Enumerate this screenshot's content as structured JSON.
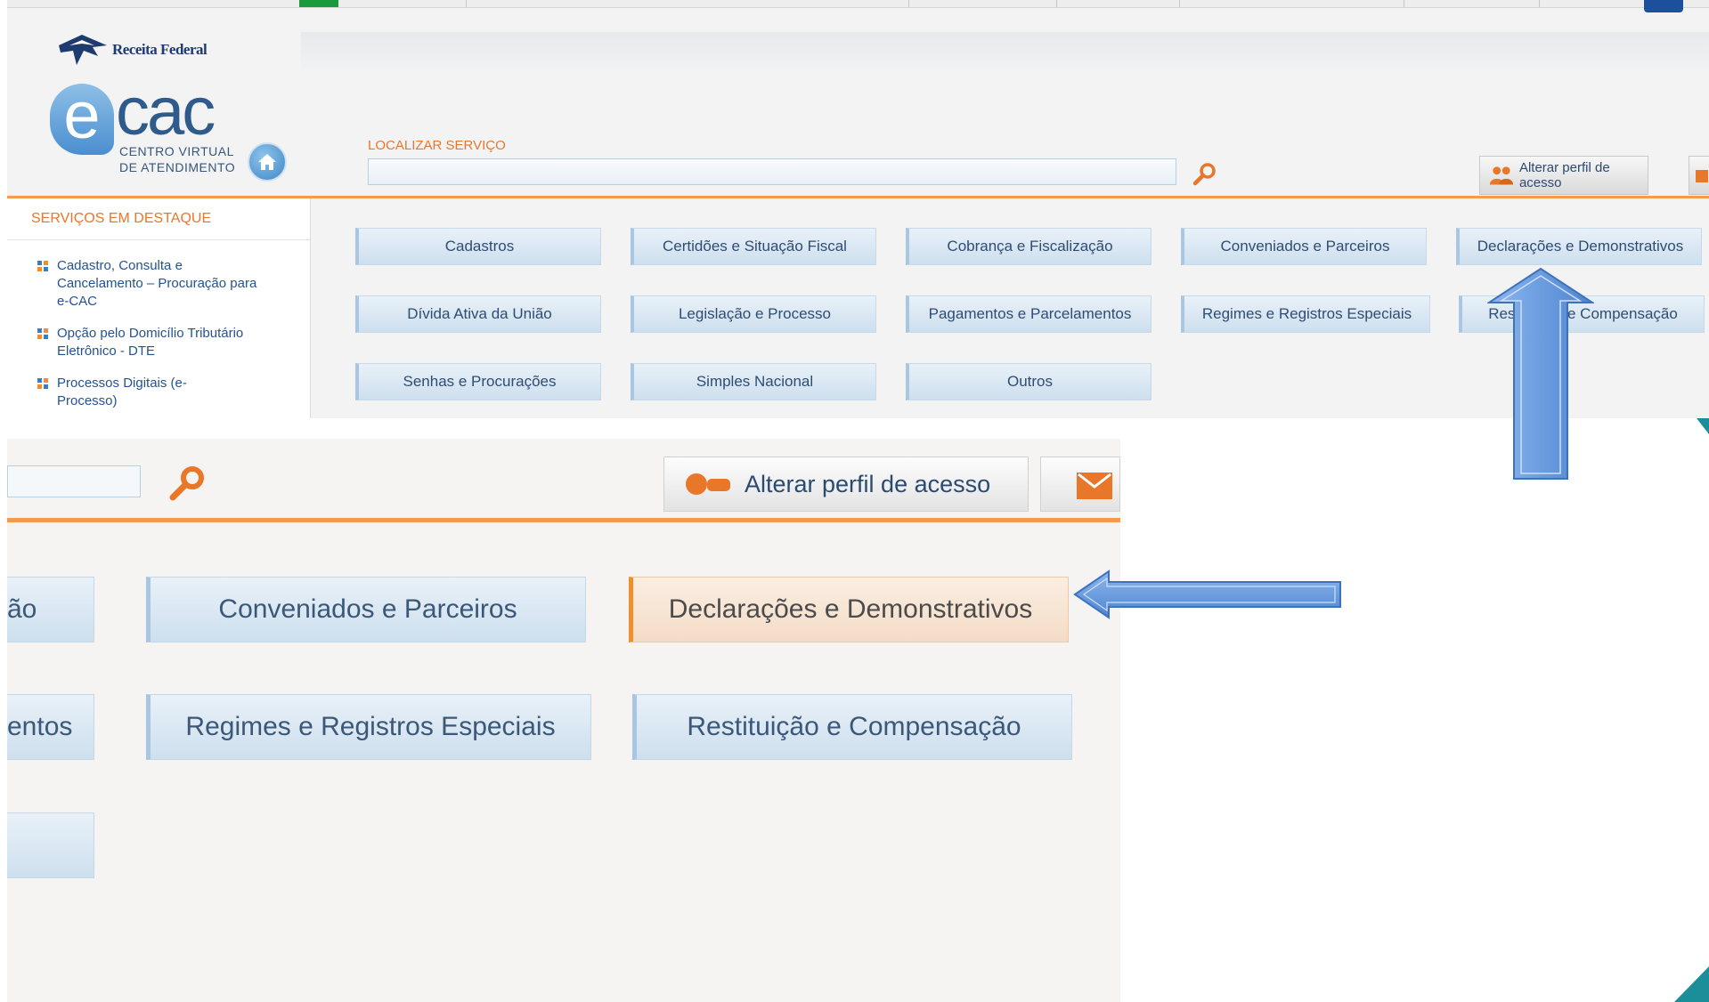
{
  "header": {
    "org_name": "Receita Federal",
    "logo_main": "cac",
    "logo_e": "e",
    "logo_sub_1": "CENTRO VIRTUAL",
    "logo_sub_2": "DE ATENDIMENTO",
    "home_icon": "home-icon"
  },
  "search": {
    "label": "LOCALIZAR SERVIÇO",
    "value": "",
    "placeholder": "",
    "icon": "magnifier-icon"
  },
  "toolbar": {
    "profile_label": "Alterar perfil de acesso",
    "profile_icon": "users-icon"
  },
  "featured": {
    "title": "SERVIÇOS EM DESTAQUE",
    "items": [
      {
        "label": "Cadastro, Consulta e Cancelamento – Procuração para e-CAC"
      },
      {
        "label": "Opção pelo Domicílio Tributário Eletrônico - DTE"
      },
      {
        "label": "Processos Digitais (e-Processo)"
      }
    ]
  },
  "menu": {
    "row1": [
      "Cadastros",
      "Certidões e Situação Fiscal",
      "Cobrança e Fiscalização",
      "Conveniados e Parceiros",
      "Declarações e Demonstrativos"
    ],
    "row2": [
      "Dívida Ativa da União",
      "Legislação e Processo",
      "Pagamentos e Parcelamentos",
      "Regimes e Registros Especiais",
      "Restituição e Compensação"
    ],
    "row3": [
      "Senhas e Procurações",
      "Simples Nacional",
      "Outros"
    ]
  },
  "zoom": {
    "partial_1": "ão",
    "partial_2": "entos",
    "conveniados": "Conveniados e Parceiros",
    "declaracoes": "Declarações e Demonstrativos",
    "regimes": "Regimes e Registros Especiais",
    "restituicao": "Restituição e Compensação",
    "profile_label": "Alterar perfil de acesso"
  },
  "colors": {
    "accent_orange": "#f39a4d",
    "link_blue": "#24538f",
    "arrow_blue": "#5a8fd6",
    "teal": "#1a8f9a"
  }
}
